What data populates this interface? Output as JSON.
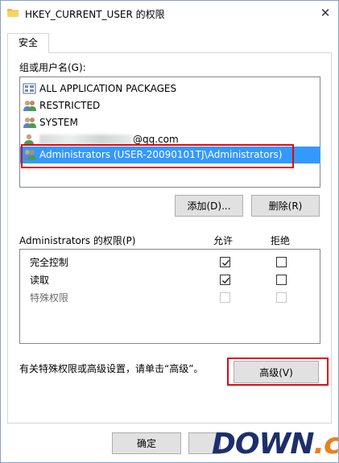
{
  "window": {
    "title": "HKEY_CURRENT_USER 的权限",
    "close_glyph": "✕"
  },
  "tab": {
    "label": "安全"
  },
  "groups": {
    "label": "组或用户名(G):",
    "items": [
      {
        "label": "ALL APPLICATION PACKAGES",
        "icon": "app-packages-icon"
      },
      {
        "label": "RESTRICTED",
        "icon": "user-group-icon"
      },
      {
        "label": "SYSTEM",
        "icon": "user-group-icon"
      },
      {
        "label": "@qq.com",
        "icon": "user-icon"
      },
      {
        "label": "Administrators (USER-20090101TJ\\Administrators)",
        "icon": "user-group-icon",
        "selected": true
      }
    ]
  },
  "buttons": {
    "add": "添加(D)...",
    "remove": "删除(R)",
    "advanced": "高级(V)",
    "ok": "确定"
  },
  "permissions": {
    "label": "Administrators 的权限(P)",
    "allow_header": "允许",
    "deny_header": "拒绝",
    "rows": [
      {
        "label": "完全控制",
        "allow": true,
        "deny": false,
        "disabled": false
      },
      {
        "label": "读取",
        "allow": true,
        "deny": false,
        "disabled": false
      },
      {
        "label": "特殊权限",
        "allow": false,
        "deny": false,
        "disabled": true
      }
    ]
  },
  "advanced_hint": "有关特殊权限或高级设置，请单击“高级”。",
  "watermark": {
    "part1": "D",
    "part2": "O",
    "part3": "WN",
    "part4": ".cc"
  },
  "colors": {
    "selection": "#3399ff",
    "highlight_box": "#e30613",
    "watermark_blue": "#1d2f6b",
    "watermark_orange": "#e8811f"
  }
}
